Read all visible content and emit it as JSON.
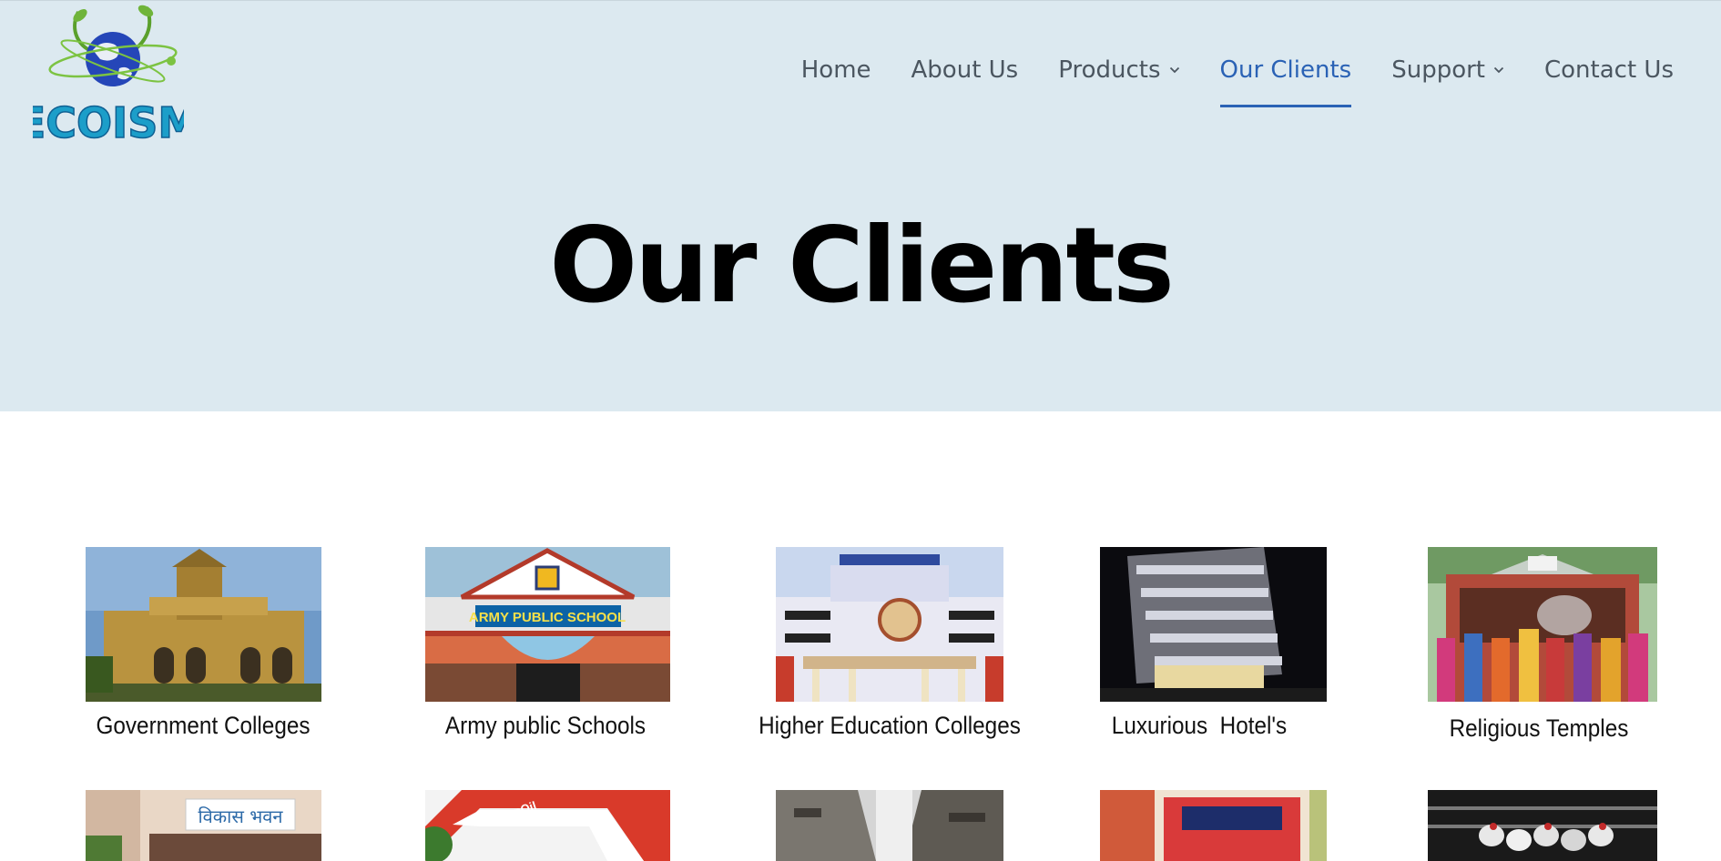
{
  "logo": {
    "text": "ECOISM",
    "alt": "Ecoism logo"
  },
  "nav": {
    "items": [
      {
        "label": "Home",
        "dropdown": false,
        "active": false
      },
      {
        "label": "About Us",
        "dropdown": false,
        "active": false
      },
      {
        "label": "Products",
        "dropdown": true,
        "active": false
      },
      {
        "label": "Our Clients",
        "dropdown": false,
        "active": true
      },
      {
        "label": "Support",
        "dropdown": true,
        "active": false
      },
      {
        "label": "Contact Us",
        "dropdown": false,
        "active": false
      }
    ]
  },
  "page": {
    "title": "Our Clients"
  },
  "clients": {
    "row1": [
      {
        "caption": "Government Colleges",
        "image": "colonial-college-building"
      },
      {
        "caption": "Army public Schools",
        "image": "army-public-school-gate"
      },
      {
        "caption": "Higher Education Colleges",
        "image": "college-building-wheel"
      },
      {
        "caption": "Luxurious  Hotel's",
        "image": "hotel-at-night"
      },
      {
        "caption": "Religious Temples",
        "image": "temple-crowd"
      }
    ],
    "row2": [
      {
        "image": "vikas-bhawan-building",
        "sign_text": "विकास भवन"
      },
      {
        "image": "indian-oil-station",
        "sign_text": "IndianOil"
      },
      {
        "image": "narrow-street"
      },
      {
        "image": "market-building"
      },
      {
        "image": "poultry-farm"
      }
    ],
    "signs": {
      "army_school": "ARMY PUBLIC SCHOOL"
    }
  },
  "colors": {
    "hero_bg": "#dce9f0",
    "accent": "#2a62b5",
    "nav_text": "#4b5660"
  }
}
